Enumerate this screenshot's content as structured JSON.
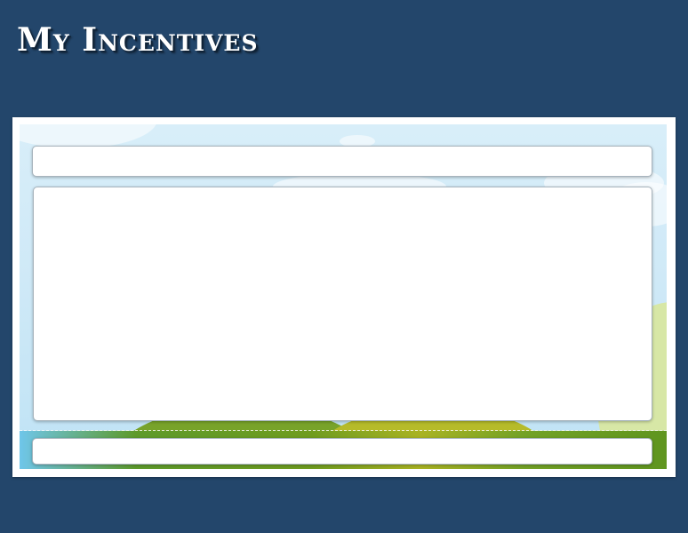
{
  "header": {
    "title": "My Incentives"
  },
  "colors": {
    "background": "#23466b",
    "frame": "#ffffff",
    "sky": "#cfe9f7",
    "ground": "#6f9c1f",
    "panel": "#ffffff"
  }
}
